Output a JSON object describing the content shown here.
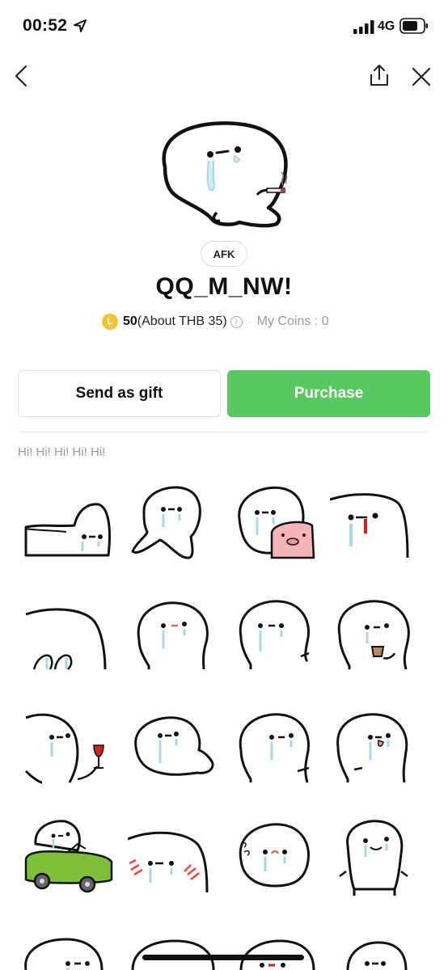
{
  "status_bar": {
    "time": "00:52",
    "network": "4G",
    "icons": [
      "location-arrow-icon",
      "signal-icon",
      "battery-icon"
    ]
  },
  "nav": {
    "icons": [
      "back-chevron-icon",
      "share-icon",
      "close-icon"
    ]
  },
  "pack": {
    "tag": "AFK",
    "title": "QQ_M_NW!",
    "coin_symbol": "L",
    "price_coins": "50",
    "price_local": "(About THB 35)",
    "info_symbol": "i",
    "separator": "·",
    "my_coins": "My Coins : 0",
    "description": "Hi! Hi! Hi! Hi! Hi!"
  },
  "actions": {
    "gift_label": "Send as gift",
    "purchase_label": "Purchase"
  },
  "colors": {
    "purchase_green": "#59c863",
    "coin_yellow": "#f2c531",
    "tear_blue": "#a9d4ea",
    "pig_pink": "#f3b5b8",
    "car_green": "#7fc03a"
  }
}
